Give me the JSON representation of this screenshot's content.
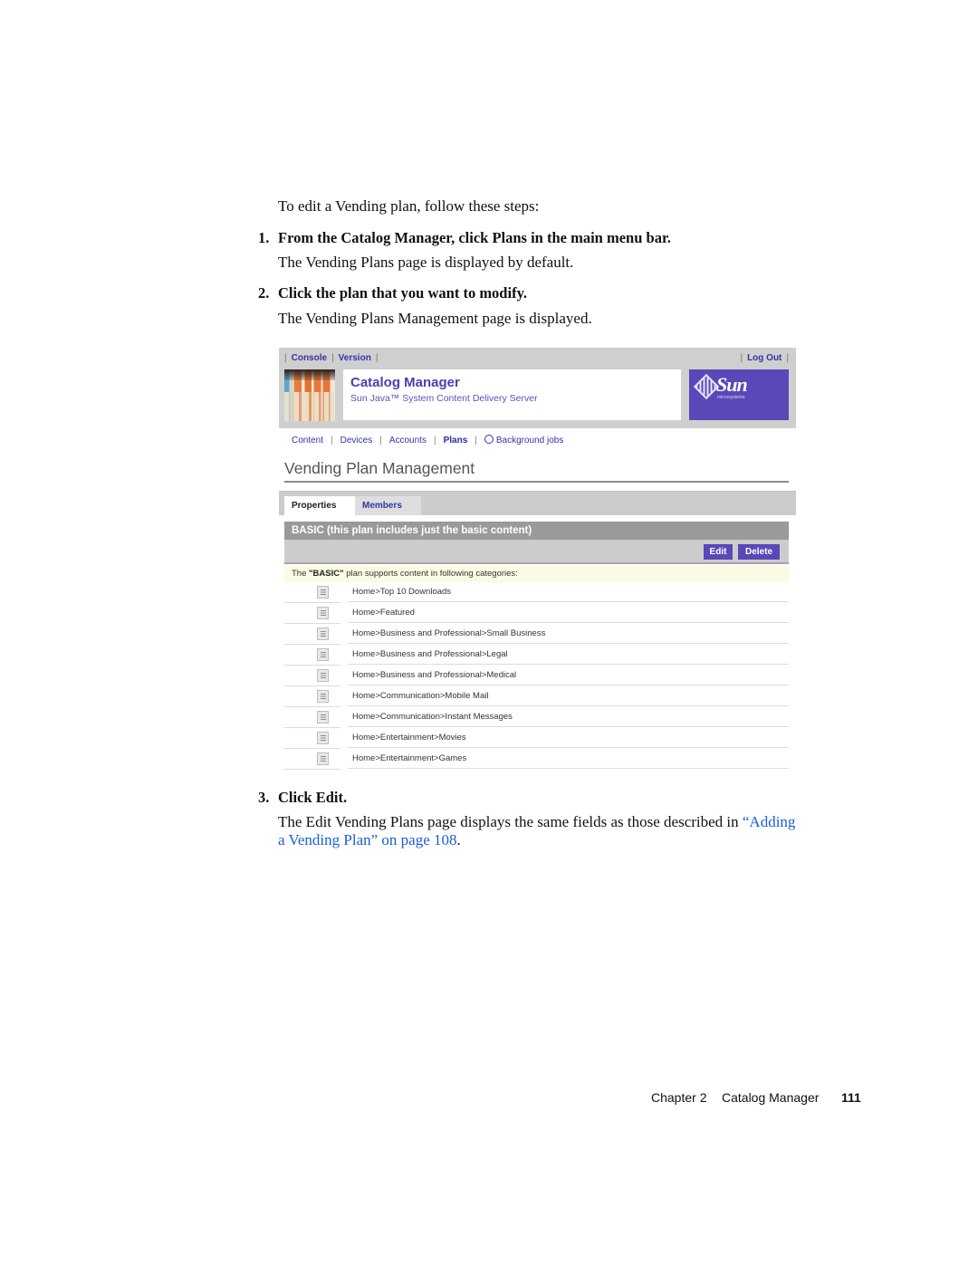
{
  "intro": "To edit a Vending plan, follow these steps:",
  "steps": [
    {
      "number": "1.",
      "instruction": "From the Catalog Manager, click Plans in the main menu bar.",
      "result": "The Vending Plans page is displayed by default."
    },
    {
      "number": "2.",
      "instruction": "Click the plan that you want to modify.",
      "result": "The Vending Plans Management page is displayed."
    },
    {
      "number": "3.",
      "instruction": "Click Edit.",
      "result_prefix": "The Edit Vending Plans page displays the same fields as those described in ",
      "result_link_line1": "“Adding",
      "result_link_line2": "a Vending Plan” on page 108",
      "result_suffix": "."
    }
  ],
  "screenshot": {
    "top_links": [
      "Console",
      "Version"
    ],
    "logout": "Log Out",
    "app_title": "Catalog Manager",
    "app_subtitle": "Sun Java™ System Content Delivery Server",
    "logo_text": "Sun",
    "logo_subtext": "microsystems",
    "main_nav": [
      {
        "label": "Content",
        "active": false
      },
      {
        "label": "Devices",
        "active": false
      },
      {
        "label": "Accounts",
        "active": false
      },
      {
        "label": "Plans",
        "active": true
      },
      {
        "label": "Background jobs",
        "active": false,
        "icon": "globe-icon"
      }
    ],
    "page_title": "Vending Plan Management",
    "tabs": [
      {
        "label": "Properties",
        "active": true
      },
      {
        "label": "Members",
        "active": false
      }
    ],
    "plan_header": "BASIC (this plan includes just the basic content)",
    "buttons": {
      "edit": "Edit",
      "delete": "Delete"
    },
    "info": {
      "prefix": "The ",
      "plan_name": "\"BASIC\"",
      "suffix": " plan supports content in following categories:"
    },
    "categories": [
      "Home>Top 10 Downloads",
      "Home>Featured",
      "Home>Business and Professional>Small Business",
      "Home>Business and Professional>Legal",
      "Home>Business and Professional>Medical",
      "Home>Communication>Mobile Mail",
      "Home>Communication>Instant Messages",
      "Home>Entertainment>Movies",
      "Home>Entertainment>Games"
    ],
    "colors": {
      "brand_purple": "#5a47b8",
      "link_blue": "#3333aa",
      "header_gray": "#9a9a9a",
      "info_yellow": "#fbfbe4"
    }
  },
  "footer": {
    "chapter": "Chapter 2",
    "section": "Catalog Manager",
    "page_number": "111"
  }
}
